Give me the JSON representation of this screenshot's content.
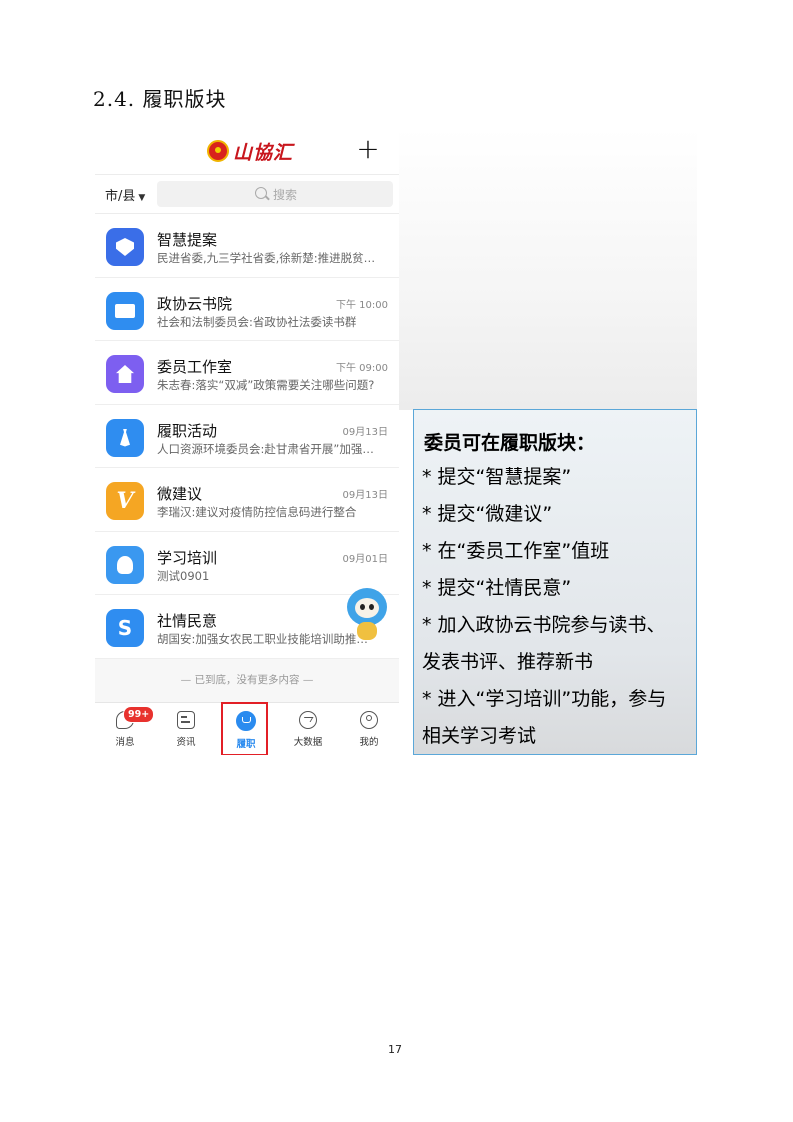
{
  "section_heading": "2.4.  履职版块",
  "app": {
    "logo_text": "山協汇",
    "plus_label": "+",
    "region_label": "市/县",
    "search_placeholder": "搜索",
    "items": [
      {
        "title": "智慧提案",
        "time": "",
        "subtitle": "民进省委,九三学社省委,徐新楚:推进脱贫…",
        "icon": "shield-icon",
        "color": "#3a6ee8"
      },
      {
        "title": "政协云书院",
        "time": "下午 10:00",
        "subtitle": "社会和法制委员会:省政协社法委读书群",
        "icon": "book-icon",
        "color": "#2f8df0"
      },
      {
        "title": "委员工作室",
        "time": "下午 09:00",
        "subtitle": "朱志春:落实“双减”政策需要关注哪些问题?",
        "icon": "house-icon",
        "color": "#7d5ff0"
      },
      {
        "title": "履职活动",
        "time": "09月13日",
        "subtitle": "人口资源环境委员会:赴甘肃省开展”加强…",
        "icon": "tie-icon",
        "color": "#2f8df0"
      },
      {
        "title": "微建议",
        "time": "09月13日",
        "subtitle": "李瑞汉:建议对疫情防控信息码进行整合",
        "icon": "v-icon",
        "color": "#f5a623"
      },
      {
        "title": "学习培训",
        "time": "09月01日",
        "subtitle": "测试0901",
        "icon": "bulb-icon",
        "color": "#3a98f0"
      },
      {
        "title": "社情民意",
        "time": "",
        "subtitle": "胡国安:加强女农民工职业技能培训助推…",
        "icon": "s-icon",
        "color": "#2f8df0"
      }
    ],
    "end_note": "— 已到底，没有更多内容 —",
    "tabs": [
      {
        "label": "消息",
        "badge": "99+"
      },
      {
        "label": "资讯"
      },
      {
        "label": "履职"
      },
      {
        "label": "大数据"
      },
      {
        "label": "我的"
      }
    ],
    "colors": {
      "accent": "#2a8bef",
      "highlight": "#e21f26",
      "badge": "#e8322e"
    }
  },
  "callout": {
    "title": "委员可在履职版块：",
    "lines": [
      "* 提交“智慧提案”",
      "* 提交“微建议”",
      "* 在“委员工作室”值班",
      "* 提交“社情民意”",
      "* 加入政协云书院参与读书、",
      "发表书评、推荐新书",
      "* 进入“学习培训”功能，参与",
      "相关学习考试"
    ]
  },
  "page_number": "17"
}
